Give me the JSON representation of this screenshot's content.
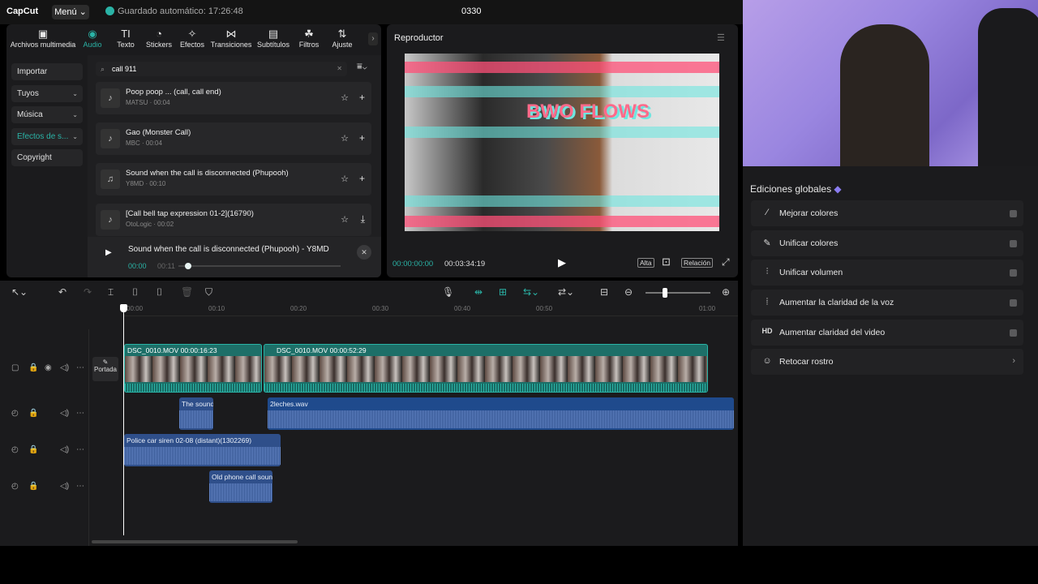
{
  "app": {
    "logo": "CapCut",
    "menu_label": "Menú ⌄",
    "autosave": "Guardado automático: 17:26:48",
    "project_title": "0330"
  },
  "tabs": [
    {
      "label": "Archivos multimedia",
      "icon": "media-icon"
    },
    {
      "label": "Audio",
      "icon": "audio-icon",
      "active": true
    },
    {
      "label": "Texto",
      "icon": "text-icon"
    },
    {
      "label": "Stickers",
      "icon": "sticker-icon"
    },
    {
      "label": "Efectos",
      "icon": "effects-icon"
    },
    {
      "label": "Transiciones",
      "icon": "transition-icon"
    },
    {
      "label": "Subtítulos",
      "icon": "subtitles-icon"
    },
    {
      "label": "Filtros",
      "icon": "filters-icon"
    },
    {
      "label": "Ajuste",
      "icon": "adjust-icon"
    }
  ],
  "sidebar": [
    {
      "label": "Importar"
    },
    {
      "label": "Tuyos",
      "chevron": true
    },
    {
      "label": "Música",
      "chevron": true
    },
    {
      "label": "Efectos de s...",
      "chevron": true,
      "active": true
    },
    {
      "label": "Copyright"
    }
  ],
  "search": {
    "value": "call 911"
  },
  "audio_results": [
    {
      "title": "Poop poop ... (call, call end)",
      "meta": "MATSU · 00:04",
      "action": "add"
    },
    {
      "title": "Gao (Monster Call)",
      "meta": "MBC · 00:04",
      "action": "add"
    },
    {
      "title": "Sound when the call is disconnected (Phupooh)",
      "meta": "Y8MD · 00:10",
      "action": "add"
    },
    {
      "title": "[Call bell tap expression 01-2](16790)",
      "meta": "OtoLogic · 00:02",
      "action": "download"
    }
  ],
  "mini_player": {
    "title": "Sound when the call is disconnected (Phupooh) - Y8MD",
    "current": "00:00",
    "duration": "00:11",
    "progress": 0.0
  },
  "player": {
    "title": "Reproductor",
    "overlay_text": "BWO FLOWS",
    "current": "00:00:00:00",
    "duration": "00:03:34:19",
    "quality": "Alta",
    "ratio": "Relación"
  },
  "global_edits": {
    "title": "Ediciones globales",
    "items": [
      {
        "label": "Mejorar colores",
        "icon": "wand-icon",
        "type": "toggle"
      },
      {
        "label": "Unificar colores",
        "icon": "brush-icon",
        "type": "toggle"
      },
      {
        "label": "Unificar volumen",
        "icon": "sliders-icon",
        "type": "toggle"
      },
      {
        "label": "Aumentar la claridad de la voz",
        "icon": "voice-wave-icon",
        "type": "toggle"
      },
      {
        "label": "Aumentar claridad del video",
        "icon": "hd-icon",
        "type": "toggle"
      },
      {
        "label": "Retocar rostro",
        "icon": "face-retouch-icon",
        "type": "chevron"
      }
    ]
  },
  "timeline": {
    "ruler_ticks": [
      "00:00",
      "00:10",
      "00:20",
      "00:30",
      "00:40",
      "00:50",
      "01:00"
    ],
    "cover_label": "Portada",
    "video_clips": [
      {
        "label": "DSC_0010.MOV   00:00:16:23"
      },
      {
        "label": "DSC_0010.MOV   00:00:52:29"
      }
    ],
    "audio_clips": [
      {
        "label": "The sound"
      },
      {
        "label": "2leches.wav"
      },
      {
        "label": "Police car siren 02-08 (distant)(1302269)"
      },
      {
        "label": "Old phone call soun"
      }
    ]
  },
  "colors": {
    "accent": "#2ab3a6",
    "panel": "#1b1b1d",
    "audio_clip": "#2f4f8a"
  }
}
